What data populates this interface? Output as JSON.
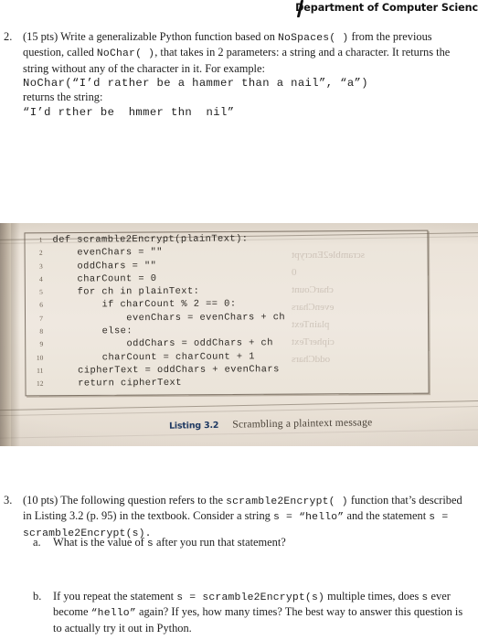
{
  "header": {
    "title": "Department of Computer Scienc",
    "pen_mark": "slash-pen-mark"
  },
  "question2": {
    "number": "2.",
    "line1_a": "(15 pts) Write a generalizable Python function based on ",
    "line1_mono": "NoSpaces(  )",
    "line1_b": " from the previous question, called ",
    "line1_mono2": "NoChar(  )",
    "line1_c": ", that takes in 2 parameters: a string and a character. It returns the string without any of the character in it. For example:",
    "example_call": "NoChar(“I’d rather be a hammer than a nail”, “a”)",
    "returns_label": "returns the string:",
    "example_result": "“I’d rther be  hmmer thn  nil”"
  },
  "listing_photo": {
    "frame": "textbook-code-listing",
    "line_numbers": [
      "1",
      "2",
      "3",
      "4",
      "5",
      "6",
      "7",
      "8",
      "9",
      "10",
      "11",
      "12"
    ],
    "code": [
      "def scramble2Encrypt(plainText):",
      "    evenChars = \"\"",
      "    oddChars = \"\"",
      "    charCount = 0",
      "    for ch in plainText:",
      "        if charCount % 2 == 0:",
      "            evenChars = evenChars + ch",
      "        else:",
      "            oddChars = oddChars + ch",
      "        charCount = charCount + 1",
      "    cipherText = oddChars + evenChars",
      "    return cipherText"
    ],
    "caption_label": "Listing 3.2",
    "caption_text": "Scrambling a plaintext message",
    "paper_color": "#ece4da",
    "caption_color": "#203a63",
    "ghost_text": [
      "scramble2Encrypt",
      "0",
      "charCount",
      "evenChars",
      "plainText",
      "cipherText",
      "oddChars"
    ]
  },
  "question3": {
    "number": "3.",
    "line1_a": "(10 pts) The following question refers to the ",
    "line1_mono": "scramble2Encrypt(  )",
    "line1_b": " function that’s described in Listing 3.2 (p. 95) in the textbook. Consider a string ",
    "line1_mono2": "s  =  “hello”",
    "line1_c": " and the statement ",
    "line1_mono3": "s  =  scramble2Encrypt(s).",
    "sub_a": {
      "label": "a.",
      "text_a": "What is the value of ",
      "mono": "s",
      "text_b": " after you run that statement?"
    },
    "sub_b": {
      "label": "b.",
      "text_a": "If you repeat the statement ",
      "mono": "s  =  scramble2Encrypt(s)",
      "text_b": " multiple times, does ",
      "mono2": "s",
      "text_c": " ever become ",
      "mono3": "“hello”",
      "text_d": " again? If yes, how many times? The best way to answer this question is to actually try it out in Python."
    }
  }
}
